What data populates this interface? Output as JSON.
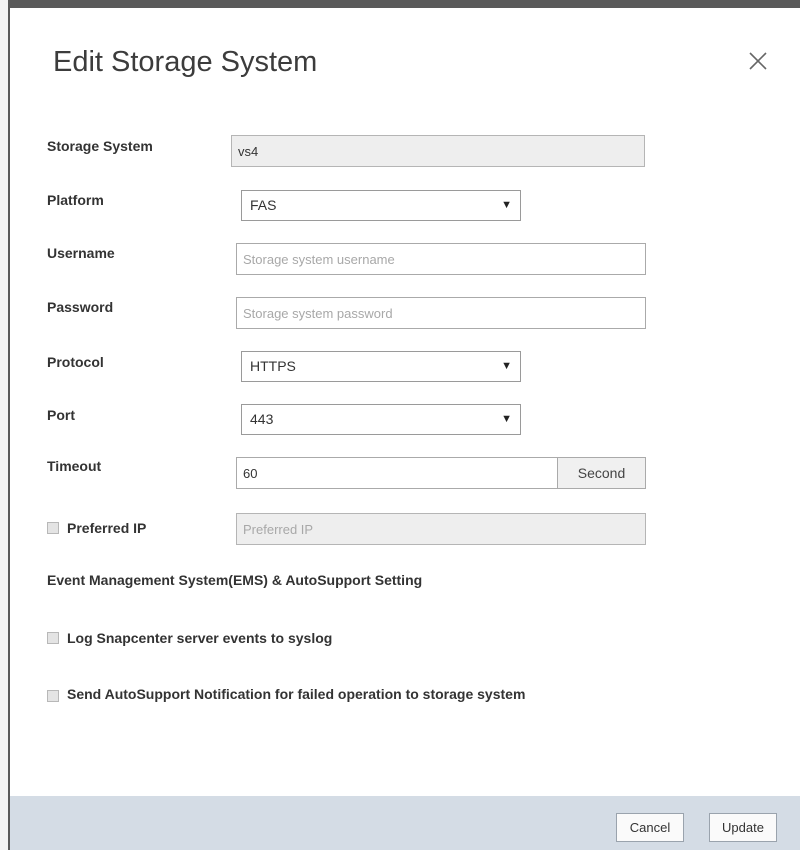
{
  "dialog": {
    "title": "Edit Storage System",
    "close_icon": "close-icon"
  },
  "form": {
    "storage_system": {
      "label": "Storage System",
      "value": "vs4"
    },
    "platform": {
      "label": "Platform",
      "value": "FAS"
    },
    "username": {
      "label": "Username",
      "value": "",
      "placeholder": "Storage system username"
    },
    "password": {
      "label": "Password",
      "value": "",
      "placeholder": "Storage system password"
    },
    "protocol": {
      "label": "Protocol",
      "value": "HTTPS"
    },
    "port": {
      "label": "Port",
      "value": "443"
    },
    "timeout": {
      "label": "Timeout",
      "value": "60",
      "unit": "Second"
    },
    "preferred_ip": {
      "label": "Preferred IP",
      "checked": false,
      "value": "",
      "placeholder": "Preferred IP"
    }
  },
  "ems": {
    "heading": "Event Management System(EMS) & AutoSupport Setting",
    "log_syslog": {
      "label": "Log Snapcenter server events to syslog",
      "checked": false
    },
    "autosupport": {
      "label": "Send AutoSupport Notification for failed operation to storage system",
      "checked": false
    }
  },
  "footer": {
    "cancel_label": "Cancel",
    "update_label": "Update"
  },
  "colors": {
    "footer_bg": "#d4dce5",
    "disabled_field_bg": "#eeeeee"
  }
}
